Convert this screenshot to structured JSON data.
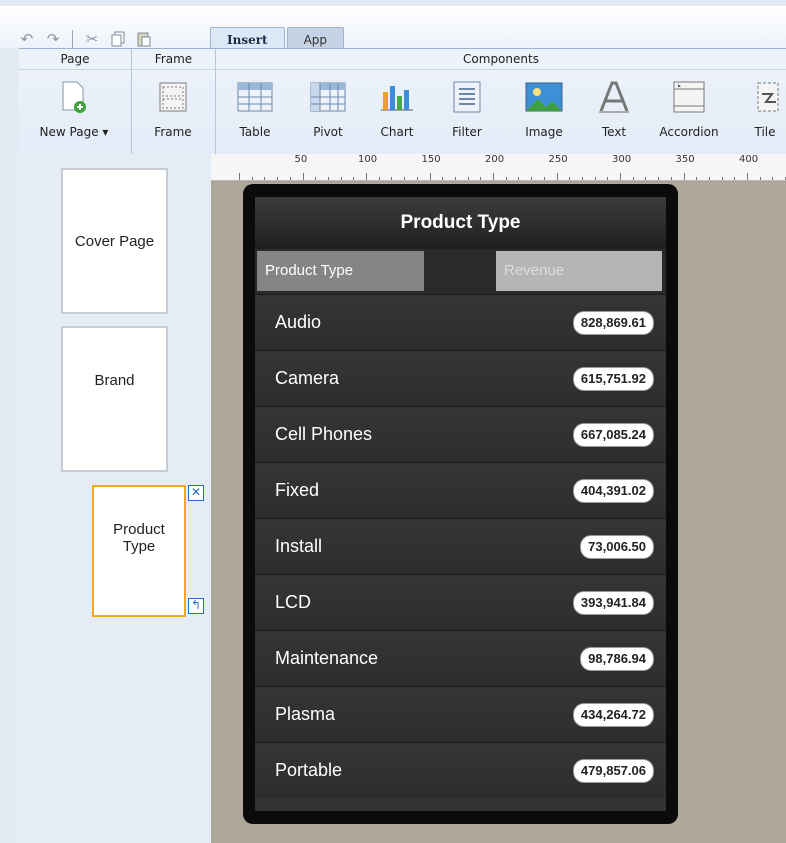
{
  "toolbar": {
    "icons": [
      "undo-icon",
      "redo-icon",
      "cut-icon",
      "copy-icon",
      "paste-icon"
    ]
  },
  "tabs": [
    {
      "label": "Insert",
      "active": true
    },
    {
      "label": "App",
      "active": false
    }
  ],
  "ribbon": {
    "groups": {
      "page": "Page",
      "frame": "Frame",
      "components": "Components"
    },
    "buttons": {
      "new_page": "New Page",
      "frame": "Frame",
      "table": "Table",
      "pivot": "Pivot",
      "chart": "Chart",
      "filter": "Filter",
      "image": "Image",
      "text": "Text",
      "accordion": "Accordion",
      "tile": "Tile"
    }
  },
  "ruler": {
    "labels": [
      "50",
      "100",
      "150",
      "200",
      "250",
      "300",
      "350",
      "400"
    ]
  },
  "pages": [
    {
      "label": "Cover Page",
      "selected": false
    },
    {
      "label": "Brand",
      "selected": false
    },
    {
      "label": "Product Type",
      "selected": true
    }
  ],
  "screen": {
    "title": "Product Type",
    "col_a": "Product Type",
    "col_b": "Revenue",
    "rows": [
      {
        "name": "Audio",
        "revenue": "828,869.61"
      },
      {
        "name": "Camera",
        "revenue": "615,751.92"
      },
      {
        "name": "Cell Phones",
        "revenue": "667,085.24"
      },
      {
        "name": "Fixed",
        "revenue": "404,391.02"
      },
      {
        "name": "Install",
        "revenue": "73,006.50"
      },
      {
        "name": "LCD",
        "revenue": "393,941.84"
      },
      {
        "name": "Maintenance",
        "revenue": "98,786.94"
      },
      {
        "name": "Plasma",
        "revenue": "434,264.72"
      },
      {
        "name": "Portable",
        "revenue": "479,857.06"
      }
    ]
  },
  "colors": {
    "selected_border": "#f5a623",
    "canvas_bg": "#ada899",
    "device_bg": "#0b0b0b"
  }
}
